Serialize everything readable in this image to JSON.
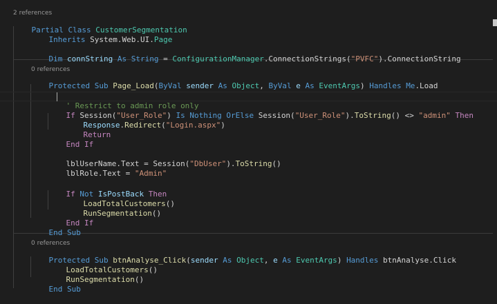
{
  "codelens": {
    "class_refs": "2 references",
    "page_load_refs": "0 references",
    "btn_click_refs": "0 references"
  },
  "colors": {
    "background": "#1e1e1e",
    "keyword": "#569cd6",
    "control": "#c586c0",
    "type": "#4ec9b0",
    "function": "#dcdcaa",
    "string": "#ce9178",
    "comment": "#6a9955",
    "variable": "#9cdcfe",
    "plain": "#d4d4d4"
  },
  "code": {
    "l1": [
      "Partial",
      " ",
      "Class",
      " ",
      "CustomerSegmentation"
    ],
    "l2": [
      "Inherits",
      " System.Web.UI.",
      "Page"
    ],
    "l3": [
      "Dim",
      " ",
      "connString",
      " ",
      "As",
      " ",
      "String",
      " = ",
      "ConfigurationManager",
      ".ConnectionStrings(",
      "\"PVFC\"",
      ").ConnectionString"
    ],
    "l4": [
      "Protected",
      " ",
      "Sub",
      " ",
      "Page_Load",
      "(",
      "ByVal",
      " ",
      "sender",
      " ",
      "As",
      " ",
      "Object",
      ", ",
      "ByVal",
      " ",
      "e",
      " ",
      "As",
      " ",
      "EventArgs",
      ") ",
      "Handles",
      " ",
      "Me",
      ".Load"
    ],
    "l5": [
      "' Restrict to admin role only"
    ],
    "l6": [
      "If",
      " Session(",
      "\"User_Role\"",
      ") ",
      "Is",
      " ",
      "Nothing",
      " ",
      "OrElse",
      " Session(",
      "\"User_Role\"",
      ").",
      "ToString",
      "() <> ",
      "\"admin\"",
      " ",
      "Then"
    ],
    "l7": [
      "Response",
      ".",
      "Redirect",
      "(",
      "\"Login.aspx\"",
      ")"
    ],
    "l8": [
      "Return"
    ],
    "l9": [
      "End",
      " ",
      "If"
    ],
    "l10": [
      "lblUserName",
      ".Text = Session(",
      "\"DbUser\"",
      ").",
      "ToString",
      "()"
    ],
    "l11": [
      "lblRole",
      ".Text = ",
      "\"Admin\""
    ],
    "l12": [
      "If",
      " ",
      "Not",
      " ",
      "IsPostBack",
      " ",
      "Then"
    ],
    "l13": [
      "LoadTotalCustomers",
      "()"
    ],
    "l14": [
      "RunSegmentation",
      "()"
    ],
    "l15": [
      "End",
      " ",
      "If"
    ],
    "l16": [
      "End",
      " ",
      "Sub"
    ],
    "l17": [
      "Protected",
      " ",
      "Sub",
      " ",
      "btnAnalyse_Click",
      "(",
      "sender",
      " ",
      "As",
      " ",
      "Object",
      ", ",
      "e",
      " ",
      "As",
      " ",
      "EventArgs",
      ") ",
      "Handles",
      " ",
      "btnAnalyse",
      ".Click"
    ],
    "l18": [
      "LoadTotalCustomers",
      "()"
    ],
    "l19": [
      "RunSegmentation",
      "()"
    ],
    "l20": [
      "End",
      " ",
      "Sub"
    ]
  }
}
